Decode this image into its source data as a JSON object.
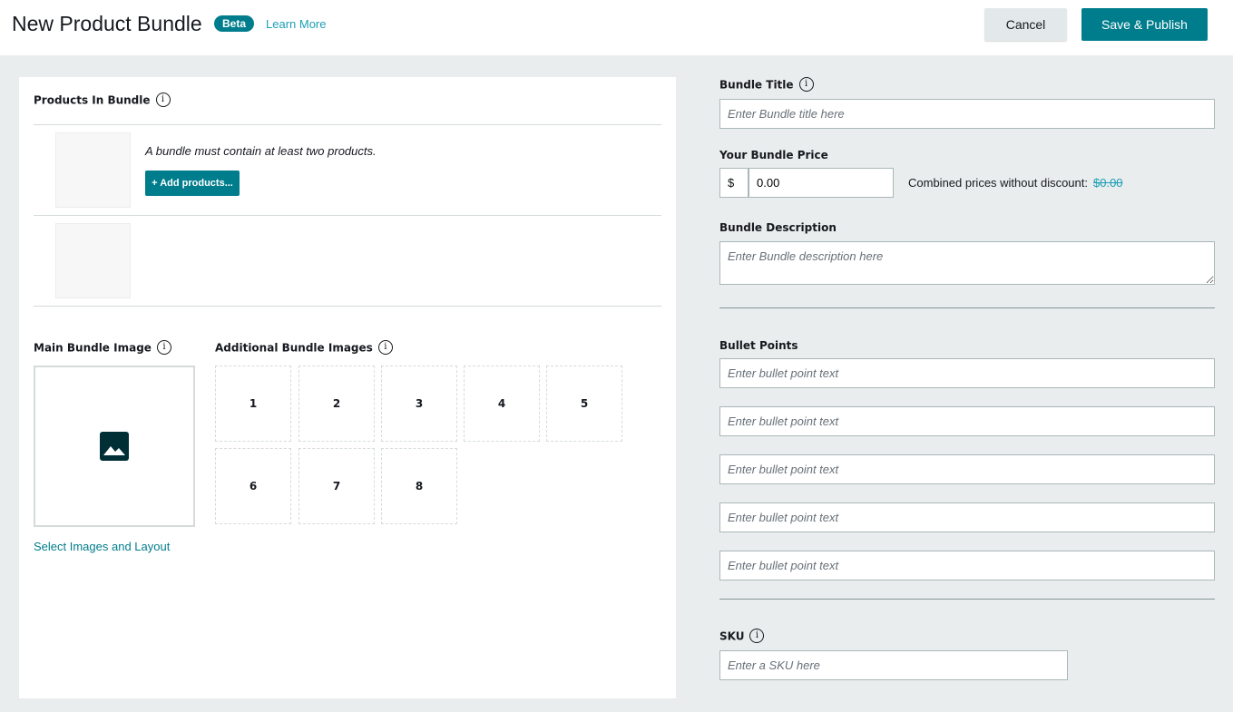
{
  "header": {
    "title": "New Product Bundle",
    "badge": "Beta",
    "learn_more": "Learn More",
    "cancel_label": "Cancel",
    "publish_label": "Save & Publish"
  },
  "products": {
    "label": "Products In Bundle",
    "hint": "A bundle must contain at least two products.",
    "add_label": "+ Add products..."
  },
  "images": {
    "main_label": "Main Bundle Image",
    "additional_label": "Additional Bundle Images",
    "slots": [
      "1",
      "2",
      "3",
      "4",
      "5",
      "6",
      "7",
      "8"
    ],
    "select_link": "Select Images and Layout"
  },
  "form": {
    "title_label": "Bundle Title",
    "title_placeholder": "Enter Bundle title here",
    "price_label": "Your Bundle Price",
    "currency": "$",
    "price_value": "0.00",
    "combined_label": "Combined prices without discount:",
    "combined_value": "$0.00",
    "description_label": "Bundle Description",
    "description_placeholder": "Enter Bundle description here",
    "bullets_label": "Bullet Points",
    "bullet_placeholder": "Enter bullet point text",
    "sku_label": "SKU",
    "sku_placeholder": "Enter a SKU here"
  },
  "icons": {
    "info": "i"
  }
}
